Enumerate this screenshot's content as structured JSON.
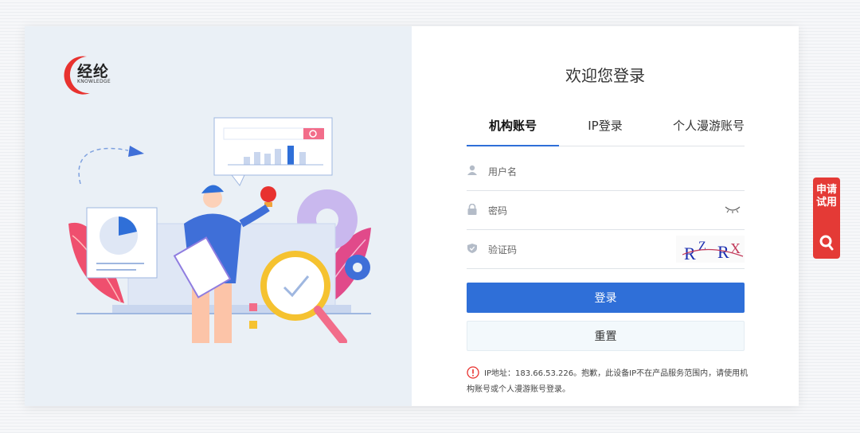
{
  "logo": {
    "name": "经纶",
    "subtitle": "KNOWLEDGE"
  },
  "login": {
    "welcome": "欢迎您登录",
    "tabs": [
      {
        "label": "机构账号",
        "active": true
      },
      {
        "label": "IP登录",
        "active": false
      },
      {
        "label": "个人漫游账号",
        "active": false
      }
    ],
    "username_placeholder": "用户名",
    "password_placeholder": "密码",
    "captcha_placeholder": "验证码",
    "captcha_text": "RZRX",
    "login_button": "登录",
    "reset_button": "重置",
    "notice": "IP地址：183.66.53.226。抱歉，此设备IP不在产品服务范围内，请使用机构账号或个人漫游账号登录。"
  },
  "side_button": {
    "label": "申请试用",
    "icon": "search-icon"
  },
  "colors": {
    "primary": "#2f6fd8",
    "accent": "#e43a36",
    "panel_bg": "#eaf0f6"
  }
}
